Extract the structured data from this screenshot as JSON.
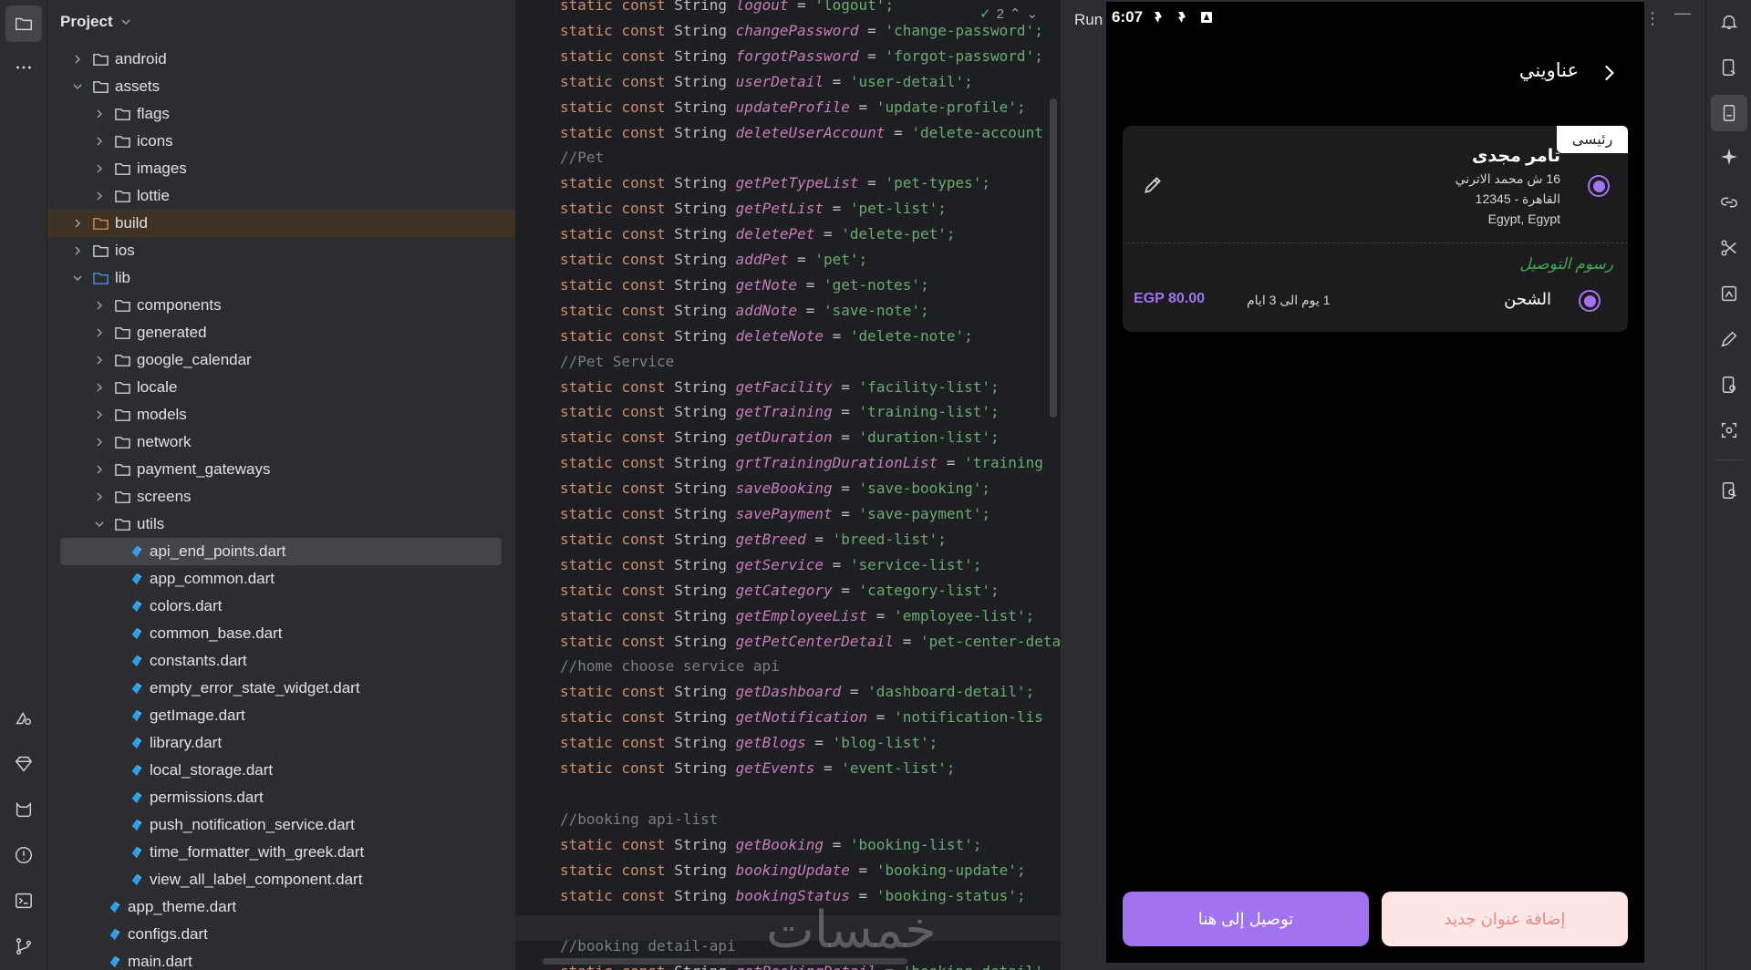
{
  "project_panel": {
    "title": "Project",
    "tree": [
      {
        "label": "android",
        "depth": 1,
        "kind": "folder",
        "expanded": false
      },
      {
        "label": "assets",
        "depth": 1,
        "kind": "folder",
        "expanded": true
      },
      {
        "label": "flags",
        "depth": 2,
        "kind": "folder",
        "expanded": false
      },
      {
        "label": "icons",
        "depth": 2,
        "kind": "folder",
        "expanded": false
      },
      {
        "label": "images",
        "depth": 2,
        "kind": "folder",
        "expanded": false
      },
      {
        "label": "lottie",
        "depth": 2,
        "kind": "folder",
        "expanded": false
      },
      {
        "label": "build",
        "depth": 1,
        "kind": "excluded",
        "expanded": false
      },
      {
        "label": "ios",
        "depth": 1,
        "kind": "folder",
        "expanded": false
      },
      {
        "label": "lib",
        "depth": 1,
        "kind": "source",
        "expanded": true
      },
      {
        "label": "components",
        "depth": 2,
        "kind": "folder",
        "expanded": false
      },
      {
        "label": "generated",
        "depth": 2,
        "kind": "folder",
        "expanded": false
      },
      {
        "label": "google_calendar",
        "depth": 2,
        "kind": "folder",
        "expanded": false
      },
      {
        "label": "locale",
        "depth": 2,
        "kind": "folder",
        "expanded": false
      },
      {
        "label": "models",
        "depth": 2,
        "kind": "folder",
        "expanded": false
      },
      {
        "label": "network",
        "depth": 2,
        "kind": "folder",
        "expanded": false
      },
      {
        "label": "payment_gateways",
        "depth": 2,
        "kind": "folder",
        "expanded": false
      },
      {
        "label": "screens",
        "depth": 2,
        "kind": "folder",
        "expanded": false
      },
      {
        "label": "utils",
        "depth": 2,
        "kind": "folder",
        "expanded": true
      },
      {
        "label": "api_end_points.dart",
        "depth": 3,
        "kind": "dart",
        "selected": true
      },
      {
        "label": "app_common.dart",
        "depth": 3,
        "kind": "dart"
      },
      {
        "label": "colors.dart",
        "depth": 3,
        "kind": "dart"
      },
      {
        "label": "common_base.dart",
        "depth": 3,
        "kind": "dart"
      },
      {
        "label": "constants.dart",
        "depth": 3,
        "kind": "dart"
      },
      {
        "label": "empty_error_state_widget.dart",
        "depth": 3,
        "kind": "dart"
      },
      {
        "label": "getImage.dart",
        "depth": 3,
        "kind": "dart"
      },
      {
        "label": "library.dart",
        "depth": 3,
        "kind": "dart"
      },
      {
        "label": "local_storage.dart",
        "depth": 3,
        "kind": "dart"
      },
      {
        "label": "permissions.dart",
        "depth": 3,
        "kind": "dart"
      },
      {
        "label": "push_notification_service.dart",
        "depth": 3,
        "kind": "dart"
      },
      {
        "label": "time_formatter_with_greek.dart",
        "depth": 3,
        "kind": "dart"
      },
      {
        "label": "view_all_label_component.dart",
        "depth": 3,
        "kind": "dart"
      },
      {
        "label": "app_theme.dart",
        "depth": 2,
        "kind": "dart"
      },
      {
        "label": "configs.dart",
        "depth": 2,
        "kind": "dart"
      },
      {
        "label": "main.dart",
        "depth": 2,
        "kind": "dart"
      }
    ]
  },
  "editor": {
    "status_count": "2",
    "code": [
      {
        "k": "decl",
        "name": "logout",
        "value": "'logout';"
      },
      {
        "k": "decl",
        "name": "changePassword",
        "value": "'change-password';"
      },
      {
        "k": "decl",
        "name": "forgotPassword",
        "value": "'forgot-password';"
      },
      {
        "k": "decl",
        "name": "userDetail",
        "value": "'user-detail';"
      },
      {
        "k": "decl",
        "name": "updateProfile",
        "value": "'update-profile';"
      },
      {
        "k": "decl",
        "name": "deleteUserAccount",
        "value": "'delete-account"
      },
      {
        "k": "comment",
        "text": "//Pet"
      },
      {
        "k": "decl",
        "name": "getPetTypeList",
        "value": "'pet-types';"
      },
      {
        "k": "decl",
        "name": "getPetList",
        "value": "'pet-list';"
      },
      {
        "k": "decl",
        "name": "deletePet",
        "value": "'delete-pet';"
      },
      {
        "k": "decl",
        "name": "addPet",
        "value": "'pet';"
      },
      {
        "k": "decl",
        "name": "getNote",
        "value": "'get-notes';"
      },
      {
        "k": "decl",
        "name": "addNote",
        "value": "'save-note';"
      },
      {
        "k": "decl",
        "name": "deleteNote",
        "value": "'delete-note';"
      },
      {
        "k": "comment",
        "text": "//Pet Service"
      },
      {
        "k": "decl",
        "name": "getFacility",
        "value": "'facility-list';"
      },
      {
        "k": "decl",
        "name": "getTraining",
        "value": "'training-list';"
      },
      {
        "k": "decl",
        "name": "getDuration",
        "value": "'duration-list';"
      },
      {
        "k": "decl",
        "name": "grtTrainingDurationList",
        "value": "'training"
      },
      {
        "k": "decl",
        "name": "saveBooking",
        "value": "'save-booking';"
      },
      {
        "k": "decl",
        "name": "savePayment",
        "value": "'save-payment';"
      },
      {
        "k": "decl",
        "name": "getBreed",
        "value": "'breed-list';"
      },
      {
        "k": "decl",
        "name": "getService",
        "value": "'service-list';"
      },
      {
        "k": "decl",
        "name": "getCategory",
        "value": "'category-list';"
      },
      {
        "k": "decl",
        "name": "getEmployeeList",
        "value": "'employee-list';"
      },
      {
        "k": "decl",
        "name": "getPetCenterDetail",
        "value": "'pet-center-detai"
      },
      {
        "k": "comment",
        "text": "//home choose service api"
      },
      {
        "k": "decl",
        "name": "getDashboard",
        "value": "'dashboard-detail';"
      },
      {
        "k": "decl",
        "name": "getNotification",
        "value": "'notification-lis"
      },
      {
        "k": "decl",
        "name": "getBlogs",
        "value": "'blog-list';"
      },
      {
        "k": "decl",
        "name": "getEvents",
        "value": "'event-list';"
      },
      {
        "k": "blank"
      },
      {
        "k": "comment",
        "text": "//booking api-list"
      },
      {
        "k": "decl",
        "name": "getBooking",
        "value": "'booking-list';"
      },
      {
        "k": "decl",
        "name": "bookingUpdate",
        "value": "'booking-update';"
      },
      {
        "k": "decl",
        "name": "bookingStatus",
        "value": "'booking-status';"
      },
      {
        "k": "blank"
      },
      {
        "k": "comment",
        "text": "//booking detail-api"
      },
      {
        "k": "decl",
        "name": "getBookingDetail",
        "value": "'booking-detail'"
      }
    ],
    "tokens": {
      "static": "static",
      "const": "const",
      "type": "String",
      "eq": "="
    },
    "watermark": "خمسات"
  },
  "run_panel": {
    "label": "Run"
  },
  "phone": {
    "time": "6:07",
    "title": "عناويني",
    "address": {
      "badge": "رئيسى",
      "name": "تامر مجدى",
      "line1": "16 ش محمد الاترني",
      "line2": "القاهرة - 12345",
      "line3": "Egypt, Egypt"
    },
    "shipping": {
      "title": "رسوم التوصيل",
      "label": "الشحن",
      "time": "1 يوم الى 3 ايام",
      "price": "EGP 80.00"
    },
    "buttons": {
      "deliver": "توصيل إلى هنا",
      "add": "إضافة عنوان جديد"
    }
  },
  "colors": {
    "accent": "#a273f0",
    "green": "#3ea94d"
  }
}
